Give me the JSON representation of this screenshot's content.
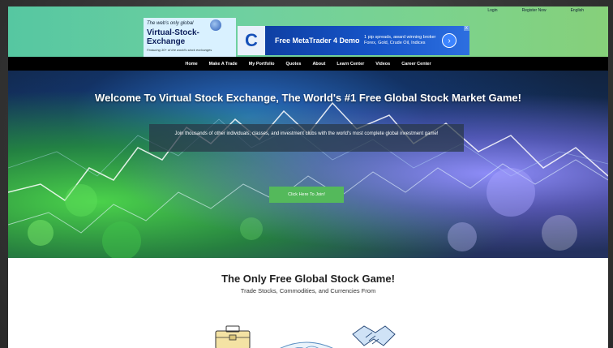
{
  "header": {
    "util_links": [
      "Login",
      "Register Now",
      "English"
    ],
    "logo": {
      "tagline": "The web's only global",
      "name": "Virtual-Stock-Exchange",
      "subtitle": "Featuring 30+ of the world's stock exchanges"
    },
    "ad": {
      "title": "Free MetaTrader 4 Demo",
      "text": "1 pip spreads, award winning broker Forex, Gold, Crude Oil, Indices",
      "close_label": "X"
    }
  },
  "nav": {
    "items": [
      "Home",
      "Make A Trade",
      "My Portfolio",
      "Quotes",
      "About",
      "Learn Center",
      "Videos",
      "Career Center"
    ]
  },
  "hero": {
    "title": "Welcome To Virtual Stock Exchange, The World's #1 Free Global Stock Market Game!",
    "description": "Join thousands of other individuals, classes, and investment clubs with the world's most complete global investment game!",
    "cta_label": "Click Here To Join!"
  },
  "content": {
    "title": "The Only Free Global Stock Game!",
    "subtitle": "Trade Stocks, Commodities, and Currencies From"
  },
  "colors": {
    "header_gradient_start": "#56c7a1",
    "nav_background": "#000000",
    "cta_button": "#54b95b"
  },
  "icons": [
    "globe-icon",
    "ad-logo-icon",
    "chevron-right-icon",
    "briefcase-icon",
    "globe-icon",
    "handshake-icon"
  ]
}
